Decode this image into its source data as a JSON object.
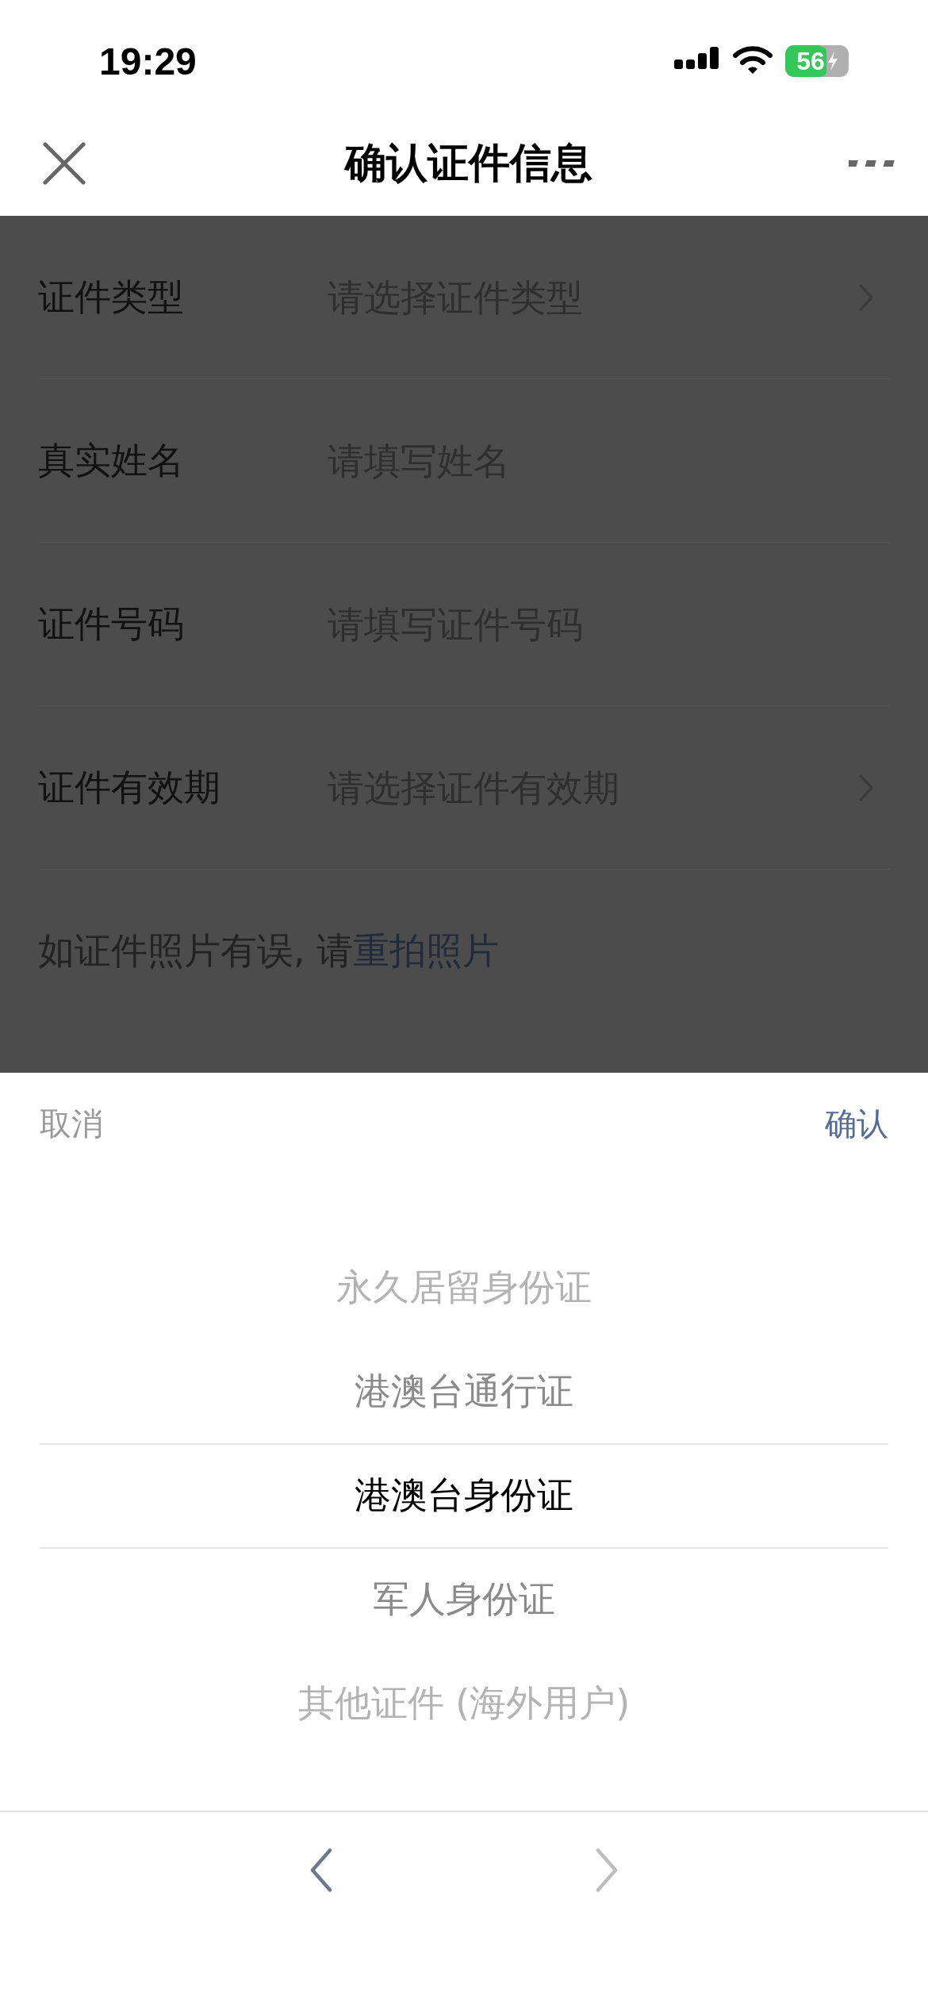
{
  "status_bar": {
    "time": "19:29",
    "battery": "56"
  },
  "nav": {
    "title": "确认证件信息"
  },
  "form": {
    "fields": [
      {
        "label": "证件类型",
        "placeholder": "请选择证件类型",
        "kind": "select"
      },
      {
        "label": "真实姓名",
        "placeholder": "请填写姓名",
        "kind": "input"
      },
      {
        "label": "证件号码",
        "placeholder": "请填写证件号码",
        "kind": "input"
      },
      {
        "label": "证件有效期",
        "placeholder": "请选择证件有效期",
        "kind": "select"
      }
    ],
    "note": {
      "text": "如证件照片有误, 请",
      "link": "重拍照片"
    }
  },
  "sheet": {
    "cancel": "取消",
    "confirm": "确认",
    "options": [
      {
        "label": "永久居留身份证",
        "selected": false
      },
      {
        "label": "港澳台通行证",
        "selected": false
      },
      {
        "label": "港澳台身份证",
        "selected": true
      },
      {
        "label": "军人身份证",
        "selected": false
      },
      {
        "label": "其他证件 (海外用户)",
        "selected": false
      }
    ]
  }
}
